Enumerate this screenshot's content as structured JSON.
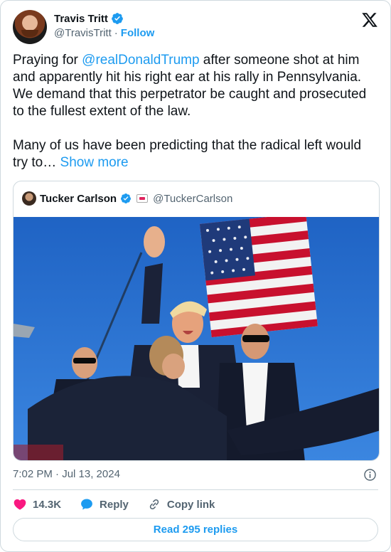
{
  "author": {
    "name": "Travis Tritt",
    "handle": "@TravisTritt",
    "separator": "·",
    "follow_label": "Follow"
  },
  "tweet": {
    "text_before_mention": "Praying for ",
    "mention": "@realDonaldTrump",
    "text_after_mention": " after someone shot at him and apparently hit his right ear at his rally in Pennsylvania. We demand that this perpetrator be caught and prosecuted to the fullest extent of the law.",
    "text_second_paragraph": "Many of us have been predicting that the radical left would try to… ",
    "show_more_label": "Show more"
  },
  "quote": {
    "name": "Tucker Carlson",
    "handle": "@TuckerCarlson"
  },
  "meta": {
    "timestamp": "7:02 PM · Jul 13, 2024"
  },
  "actions": {
    "likes": "14.3K",
    "reply_label": "Reply",
    "copy_link_label": "Copy link"
  },
  "read_replies_label": "Read 295 replies",
  "icons": {
    "verified": "verified-badge-icon",
    "logo": "x-logo-icon",
    "info": "info-icon",
    "like": "heart-icon",
    "reply": "speech-bubble-icon",
    "copy_link": "link-icon",
    "quote_badge": "affiliate-badge-icon"
  },
  "colors": {
    "accent": "#1d9bf0",
    "like": "#f91880",
    "text": "#0f1419",
    "muted": "#536471",
    "border": "#cfd9de"
  }
}
